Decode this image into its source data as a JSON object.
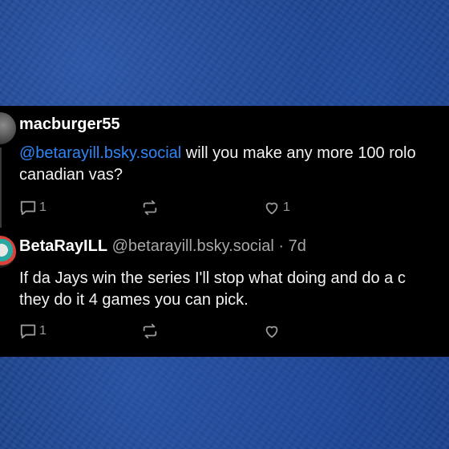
{
  "posts": [
    {
      "author": "macburger55",
      "handle": "",
      "timestamp": "",
      "mention": "@betarayill.bsky.social",
      "text": " will you make any more 100 rolos canadian vas?",
      "line1_rest": " will you make any more 100 rolo",
      "line2": "canadian vas?",
      "reply_count": "1",
      "repost_count": "",
      "like_count": "1"
    },
    {
      "author": "BetaRayILL",
      "handle": "@betarayill.bsky.social",
      "separator": " · ",
      "timestamp": "7d",
      "line1": "If da Jays win the series I'll stop what doing and do a c",
      "line2": "they do it 4 games you can pick.",
      "reply_count": "1",
      "repost_count": "",
      "like_count": ""
    }
  ],
  "icons": {
    "reply": "reply-icon",
    "repost": "repost-icon",
    "like": "heart-icon"
  },
  "colors": {
    "card_background": "#000000",
    "mention": "#2f86f6",
    "handle": "#a8a8a8",
    "icon": "#9a9a9a",
    "backdrop": "#1b3f86"
  }
}
